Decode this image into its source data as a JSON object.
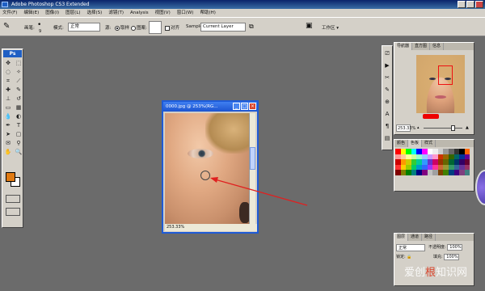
{
  "app": {
    "title": "Adobe Photoshop CS3 Extended"
  },
  "menu": [
    "文件(F)",
    "编辑(E)",
    "图像(I)",
    "图层(L)",
    "选择(S)",
    "滤镜(T)",
    "Analysis",
    "视图(V)",
    "窗口(W)",
    "帮助(H)"
  ],
  "options": {
    "brush_label": "画笔:",
    "brush_size": "9",
    "mode_label": "模式:",
    "mode_value": "正常",
    "source_label": "源:",
    "source_sampled": "取样",
    "source_pattern": "图案:",
    "aligned_label": "对齐",
    "sample_label": "Sample:",
    "sample_value": "Current Layer",
    "workspace_label": "工作区"
  },
  "tools": {
    "logo": "Ps"
  },
  "document": {
    "title": "0000.jpg @ 253%(RG...",
    "status": "253.33%"
  },
  "navigator": {
    "tabs": [
      "导航器",
      "直方图",
      "信息"
    ],
    "zoom": "253.33%"
  },
  "color": {
    "tabs": [
      "颜色",
      "色板",
      "样式"
    ],
    "swatches": [
      "#ff0000",
      "#ffff00",
      "#00ff00",
      "#00ffff",
      "#0000ff",
      "#ff00ff",
      "#ffffff",
      "#eeeeee",
      "#cccccc",
      "#999999",
      "#666666",
      "#333333",
      "#000000",
      "#ff6600",
      "#ff9999",
      "#ffcc99",
      "#ffff99",
      "#ccff99",
      "#99ffcc",
      "#99ccff",
      "#cc99ff",
      "#ff99cc",
      "#cc3300",
      "#996600",
      "#336600",
      "#006666",
      "#003399",
      "#660099",
      "#cc0000",
      "#ff9900",
      "#cccc00",
      "#33cc33",
      "#00cc99",
      "#3399ff",
      "#6633cc",
      "#cc0066",
      "#993300",
      "#666600",
      "#006633",
      "#003366",
      "#330066",
      "#660033",
      "#ff3333",
      "#ffcc00",
      "#99cc00",
      "#00cc66",
      "#0099cc",
      "#3366ff",
      "#9933ff",
      "#ff3399",
      "#cc6633",
      "#999933",
      "#339966",
      "#336699",
      "#663399",
      "#993366",
      "#800000",
      "#808000",
      "#008000",
      "#008080",
      "#000080",
      "#800080",
      "#c0c0c0",
      "#a0a0a0",
      "#804000",
      "#408000",
      "#004080",
      "#400080",
      "#804080",
      "#408080"
    ]
  },
  "layers": {
    "tabs": [
      "图层",
      "通道",
      "路径"
    ],
    "blend_mode": "正常",
    "opacity_label": "不透明度:",
    "opacity": "100%",
    "lock_label": "锁定:",
    "fill_label": "填充:",
    "fill": "100%"
  },
  "watermark": {
    "text_left": "爱创",
    "text_red": "根",
    "text_right": "知识网"
  }
}
